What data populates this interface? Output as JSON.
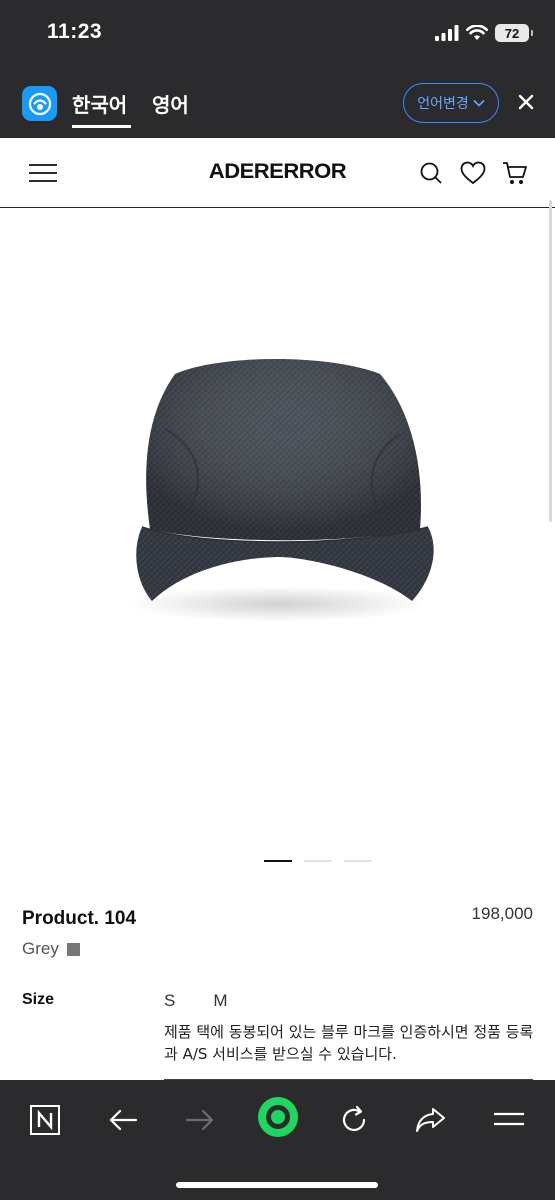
{
  "status": {
    "time": "11:23",
    "battery": "72"
  },
  "translate_bar": {
    "tab_korean": "한국어",
    "tab_english": "영어",
    "change_language": "언어변경"
  },
  "site": {
    "brand": "ADERERROR"
  },
  "product": {
    "name": "Product. 104",
    "price": "198,000",
    "color": "Grey",
    "swatch_color": "#777777",
    "size_label": "Size",
    "sizes": [
      "S",
      "M"
    ],
    "notice": "제품 택에 동봉되어 있는 블루 마크를 인증하시면 정품 등록과 A/S 서비스를 받으실 수 있습니다.",
    "image_count": 3,
    "active_image": 1
  },
  "colors": {
    "bar_bg": "#2b2b2d",
    "accent_blue": "#3b8cff",
    "accent_green": "#1ed760"
  }
}
